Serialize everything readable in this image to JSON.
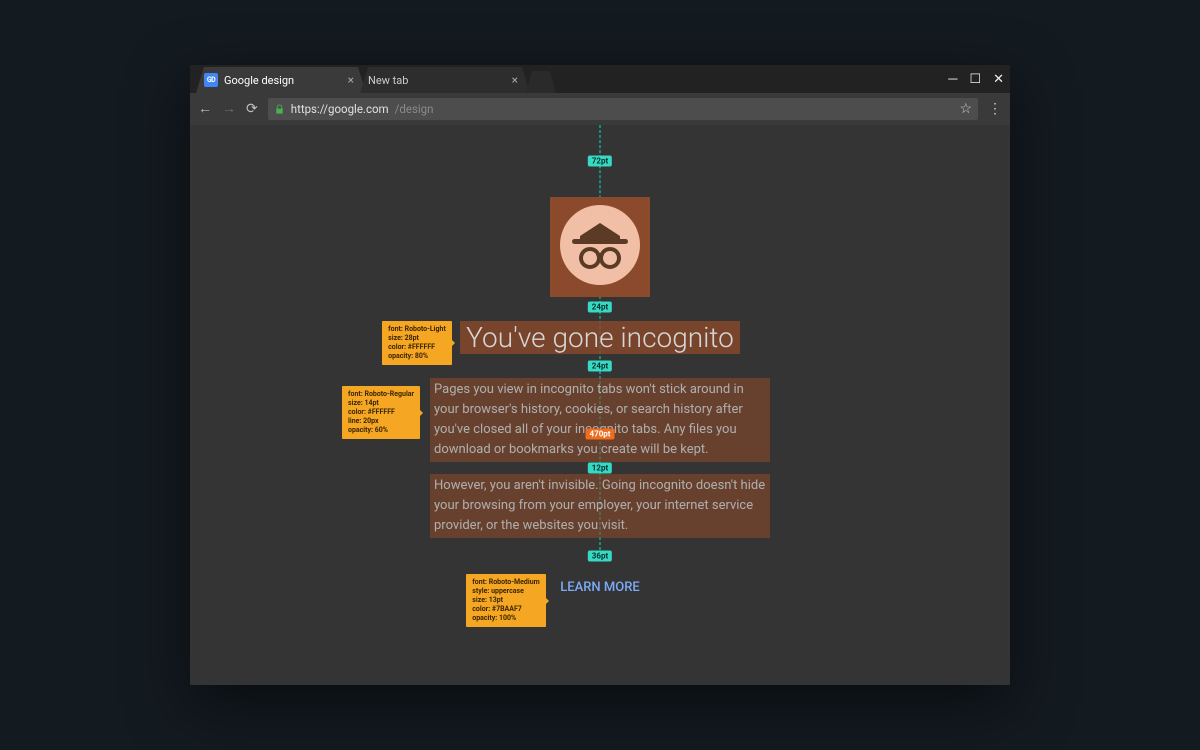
{
  "tabs": [
    {
      "label": "Google design",
      "favicon": "GD"
    },
    {
      "label": "New tab",
      "favicon": ""
    }
  ],
  "url": {
    "origin": "https://google.com",
    "path": "/design"
  },
  "page": {
    "title": "You've gone incognito",
    "p1": "Pages you view in incognito tabs won't stick around in your browser's history, cookies, or search history after you've closed all of your incognito tabs. Any files you download or bookmarks you create will be kept.",
    "p2": "However, you aren't invisible. Going incognito doesn't hide your browsing from your employer, your internet service provider, or the websites you visit.",
    "learn": "LEARN MORE"
  },
  "spacing": {
    "top": "72pt",
    "after_icon": "24pt",
    "after_title": "24pt",
    "column_width": "470pt",
    "body_gap": "12pt",
    "before_button": "36pt"
  },
  "spec_title": "font: Roboto-Light\nsize: 28pt\ncolor: #FFFFFF\nopacity: 80%",
  "spec_body": "font: Roboto-Regular\nsize: 14pt\ncolor: #FFFFFF\nline: 20px\nopacity: 60%",
  "spec_learn": "font: Roboto-Medium\nstyle: uppercase\nsize: 13pt\ncolor: #7BAAF7\nopacity: 100%"
}
